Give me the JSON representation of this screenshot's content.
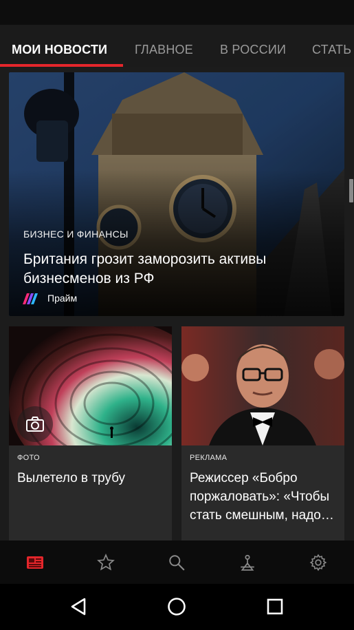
{
  "tabs": [
    {
      "label": "МОИ НОВОСТИ",
      "active": true
    },
    {
      "label": "ГЛАВНОЕ",
      "active": false
    },
    {
      "label": "В РОССИИ",
      "active": false
    },
    {
      "label": "СТАТЬ",
      "active": false
    }
  ],
  "colors": {
    "accent": "#e4262b",
    "tab_bar": "#1b1b1b",
    "card_bg": "#2a2a2a",
    "nav_bg": "#0c0c0c"
  },
  "hero": {
    "category": "БИЗНЕС И ФИНАНСЫ",
    "title": "Британия грозит заморозить активы бизнесменов из РФ",
    "source": "Прайм",
    "source_logo": "praim-logo"
  },
  "cards": [
    {
      "category": "ФОТО",
      "title": "Вылетело в трубу",
      "badge_icon": "camera-icon"
    },
    {
      "category": "РЕКЛАМА",
      "title": "Режиссер «Бобро поржаловать»: «Чтобы стать смешным, надо…"
    }
  ],
  "bottom_nav": {
    "items": [
      "news-icon",
      "star-icon",
      "search-icon",
      "radar-icon",
      "gear-icon"
    ],
    "active_index": 0
  },
  "system_nav": {
    "items": [
      "back-icon",
      "home-icon",
      "recents-icon"
    ]
  }
}
